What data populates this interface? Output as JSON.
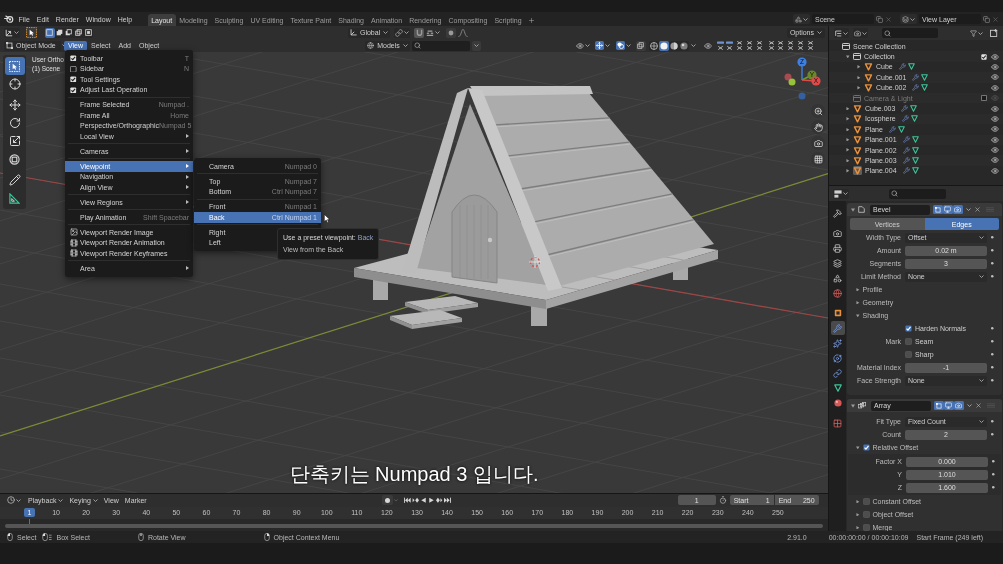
{
  "top_bar": {
    "menus": [
      "File",
      "Edit",
      "Render",
      "Window",
      "Help"
    ],
    "workspaces": [
      {
        "label": "Layout",
        "selected": true
      },
      {
        "label": "Modeling",
        "selected": false
      },
      {
        "label": "Sculpting",
        "selected": false
      },
      {
        "label": "UV Editing",
        "selected": false
      },
      {
        "label": "Texture Paint",
        "selected": false
      },
      {
        "label": "Shading",
        "selected": false
      },
      {
        "label": "Animation",
        "selected": false
      },
      {
        "label": "Rendering",
        "selected": false
      },
      {
        "label": "Compositing",
        "selected": false
      },
      {
        "label": "Scripting",
        "selected": false
      }
    ],
    "scene": "Scene",
    "view_layer": "View Layer"
  },
  "tool_settings": {
    "select_modes": [
      {
        "kind": "set",
        "selected": true
      },
      {
        "kind": "extend",
        "selected": false
      },
      {
        "kind": "subtract",
        "selected": false
      },
      {
        "kind": "difference",
        "selected": false
      },
      {
        "kind": "intersect",
        "selected": false
      }
    ],
    "orientation": "Global",
    "options": "Options"
  },
  "viewport_header": {
    "mode": "Object Mode",
    "menus": [
      {
        "label": "View",
        "selected": true
      },
      {
        "label": "Select",
        "selected": false
      },
      {
        "label": "Add",
        "selected": false
      },
      {
        "label": "Object",
        "selected": false
      }
    ],
    "collection": "Models",
    "gizmos": {
      "on": true
    },
    "overlays": {
      "on": true
    },
    "xray": {
      "on": false
    },
    "shading": [
      {
        "kind": "wireframe",
        "selected": false
      },
      {
        "kind": "solid",
        "selected": true
      },
      {
        "kind": "material",
        "selected": false
      },
      {
        "kind": "rendered",
        "selected": false
      }
    ]
  },
  "toolbar": {
    "groups": [
      {
        "tools": [
          {
            "kind": "select_box",
            "selected": true
          },
          {
            "kind": "cursor",
            "selected": false
          }
        ]
      },
      {
        "tools": [
          {
            "kind": "move",
            "selected": false
          },
          {
            "kind": "rotate",
            "selected": false
          },
          {
            "kind": "scale",
            "selected": false
          },
          {
            "kind": "transform",
            "selected": false
          }
        ]
      },
      {
        "tools": [
          {
            "kind": "annotate",
            "selected": false
          },
          {
            "kind": "measure",
            "selected": false
          }
        ]
      }
    ]
  },
  "viewport": {
    "view_name": "User Ortho",
    "scene_info": "(1) Scene",
    "gizmo_axes": [
      "Z",
      "Y",
      "X"
    ],
    "subtitle": "단축키는 Numpad 3 입니다."
  },
  "view_menu": {
    "sections": [
      {
        "items": [
          {
            "kind": "check",
            "label": "Toolbar",
            "checked": true,
            "shortcut": "T",
            "selected": false
          },
          {
            "kind": "check",
            "label": "Sidebar",
            "checked": false,
            "shortcut": "N",
            "selected": false
          },
          {
            "kind": "check",
            "label": "Tool Settings",
            "checked": true,
            "selected": false
          },
          {
            "kind": "check",
            "label": "Adjust Last Operation",
            "checked": true,
            "selected": false
          }
        ]
      },
      {
        "items": [
          {
            "kind": "action",
            "label": "Frame Selected",
            "shortcut": "Numpad .",
            "selected": false
          },
          {
            "kind": "action",
            "label": "Frame All",
            "shortcut": "Home",
            "selected": false
          },
          {
            "kind": "action",
            "label": "Perspective/Orthographic",
            "shortcut": "Numpad 5",
            "selected": false
          },
          {
            "kind": "submenu",
            "label": "Local View",
            "selected": false
          }
        ]
      },
      {
        "items": [
          {
            "kind": "submenu",
            "label": "Cameras",
            "selected": false
          }
        ]
      },
      {
        "items": [
          {
            "kind": "submenu",
            "label": "Viewpoint",
            "selected": true
          },
          {
            "kind": "submenu",
            "label": "Navigation",
            "selected": false
          },
          {
            "kind": "submenu",
            "label": "Align View",
            "selected": false
          }
        ]
      },
      {
        "items": [
          {
            "kind": "submenu",
            "label": "View Regions",
            "selected": false
          }
        ]
      },
      {
        "items": [
          {
            "kind": "action",
            "label": "Play Animation",
            "shortcut": "Shift Spacebar",
            "selected": false
          }
        ]
      },
      {
        "items": [
          {
            "kind": "render_image",
            "label": "Viewport Render Image",
            "selected": false
          },
          {
            "kind": "render_animation",
            "label": "Viewport Render Animation",
            "selected": false
          },
          {
            "kind": "render_animation",
            "label": "Viewport Render Keyframes",
            "selected": false
          }
        ]
      },
      {
        "items": [
          {
            "kind": "submenu",
            "label": "Area",
            "selected": false
          }
        ]
      }
    ]
  },
  "viewpoint_menu": {
    "sections": [
      {
        "items": [
          {
            "kind": "action",
            "label": "Camera",
            "shortcut": "Numpad 0",
            "selected": false
          }
        ]
      },
      {
        "items": [
          {
            "kind": "action",
            "label": "Top",
            "shortcut": "Numpad 7",
            "selected": false
          },
          {
            "kind": "action",
            "label": "Bottom",
            "shortcut": "Ctrl Numpad 7",
            "selected": false
          }
        ]
      },
      {
        "items": [
          {
            "kind": "action",
            "label": "Front",
            "shortcut": "Numpad 1",
            "selected": false
          },
          {
            "kind": "action",
            "label": "Back",
            "shortcut": "Ctrl Numpad 1",
            "selected": true
          }
        ]
      },
      {
        "items": [
          {
            "kind": "action",
            "label": "Right",
            "selected": false
          },
          {
            "kind": "action",
            "label": "Left",
            "selected": false
          }
        ]
      }
    ]
  },
  "tooltip": {
    "label": "Use a preset viewpoint:",
    "value": "Back",
    "description": "View from the Back"
  },
  "outliner": {
    "tree": [
      {
        "kind": "scene_collection",
        "label": "Scene Collection",
        "children": [
          {
            "kind": "collection",
            "label": "Collection",
            "expanded": true,
            "checked": true,
            "children": [
              {
                "kind": "object",
                "label": "Cube",
                "expanded": false,
                "selected": false
              },
              {
                "kind": "object",
                "label": "Cube.001",
                "expanded": false,
                "selected": false
              },
              {
                "kind": "object",
                "label": "Cube.002",
                "expanded": false,
                "selected": false
              }
            ]
          },
          {
            "kind": "collection",
            "label": "Camera & Light",
            "checked": false
          },
          {
            "kind": "object",
            "label": "Cube.003",
            "expanded": false,
            "selected": false
          },
          {
            "kind": "object",
            "label": "Icosphere",
            "expanded": false,
            "selected": false
          },
          {
            "kind": "object",
            "label": "Plane",
            "expanded": false,
            "selected": false
          },
          {
            "kind": "object",
            "label": "Plane.001",
            "expanded": false,
            "selected": false
          },
          {
            "kind": "object",
            "label": "Plane.002",
            "expanded": false,
            "selected": false
          },
          {
            "kind": "object",
            "label": "Plane.003",
            "expanded": false,
            "selected": false
          },
          {
            "kind": "object",
            "label": "Plane.004",
            "expanded": false,
            "selected": true
          }
        ]
      }
    ]
  },
  "properties": {
    "tab_groups": [
      {
        "tabs": [
          {
            "kind": "tool",
            "selected": false
          }
        ]
      },
      {
        "tabs": [
          {
            "kind": "render",
            "selected": false
          },
          {
            "kind": "output",
            "selected": false
          },
          {
            "kind": "view_layer",
            "selected": false
          },
          {
            "kind": "scene",
            "selected": false
          },
          {
            "kind": "world",
            "selected": false
          }
        ]
      },
      {
        "tabs": [
          {
            "kind": "object",
            "selected": false
          },
          {
            "kind": "modifier",
            "selected": true
          },
          {
            "kind": "particles",
            "selected": false
          },
          {
            "kind": "physics",
            "selected": false
          },
          {
            "kind": "constraints",
            "selected": false
          },
          {
            "kind": "data",
            "selected": false
          },
          {
            "kind": "material",
            "selected": false
          }
        ]
      },
      {
        "tabs": [
          {
            "kind": "texture",
            "selected": false
          }
        ]
      }
    ],
    "modifiers": [
      {
        "kind": "bevel",
        "name": "Bevel",
        "expanded": true,
        "toggles": [
          {
            "kind": "edit_mode",
            "on": true
          },
          {
            "kind": "viewport",
            "on": true
          },
          {
            "kind": "render",
            "on": true
          }
        ],
        "segments": [
          {
            "label": "Vertices",
            "selected": false
          },
          {
            "label": "Edges",
            "selected": true
          }
        ],
        "rows": [
          {
            "kind": "dropdown",
            "label": "Width Type",
            "value": "Offset"
          },
          {
            "kind": "number",
            "label": "Amount",
            "value": "0.02 m"
          },
          {
            "kind": "number",
            "label": "Segments",
            "value": "3"
          },
          {
            "kind": "dropdown",
            "label": "Limit Method",
            "value": "None"
          },
          {
            "kind": "subpanel",
            "label": "Profile",
            "expanded": false
          },
          {
            "kind": "subpanel",
            "label": "Geometry",
            "expanded": false
          },
          {
            "kind": "subpanel",
            "label": "Shading",
            "expanded": true,
            "rows": [
              {
                "kind": "checkbox",
                "label": "Harden Normals",
                "checked": true
              },
              {
                "kind": "checkbox",
                "heading": "Mark",
                "label": "Seam",
                "checked": false
              },
              {
                "kind": "checkbox",
                "label": "Sharp",
                "checked": false
              },
              {
                "kind": "number",
                "label": "Material Index",
                "value": "-1"
              },
              {
                "kind": "dropdown",
                "label": "Face Strength",
                "value": "None"
              }
            ]
          }
        ]
      },
      {
        "kind": "array",
        "name": "Array",
        "expanded": true,
        "toggles": [
          {
            "kind": "edit_mode",
            "on": true
          },
          {
            "kind": "viewport",
            "on": true
          },
          {
            "kind": "render",
            "on": true
          }
        ],
        "rows": [
          {
            "kind": "dropdown",
            "label": "Fit Type",
            "value": "Fixed Count"
          },
          {
            "kind": "number",
            "label": "Count",
            "value": "2"
          },
          {
            "kind": "subpanel_check",
            "label": "Relative Offset",
            "expanded": true,
            "checked": true,
            "rows": [
              {
                "kind": "number",
                "label": "Factor X",
                "value": "0.000"
              },
              {
                "kind": "number",
                "label": "Y",
                "value": "1.010"
              },
              {
                "kind": "number",
                "label": "Z",
                "value": "1.600"
              }
            ]
          },
          {
            "kind": "subpanel_check",
            "label": "Constant Offset",
            "expanded": false,
            "checked": false
          },
          {
            "kind": "subpanel_check",
            "label": "Object Offset",
            "expanded": false,
            "checked": false
          },
          {
            "kind": "subpanel_check",
            "label": "Merge",
            "expanded": false,
            "checked": false
          }
        ]
      }
    ]
  },
  "timeline": {
    "menus": [
      {
        "label": "Playback",
        "kind": "dropdown"
      },
      {
        "label": "Keying",
        "kind": "dropdown"
      },
      {
        "label": "View",
        "kind": "menu"
      },
      {
        "label": "Marker",
        "kind": "menu"
      }
    ],
    "current_frame": "1",
    "start_label": "Start",
    "start": "1",
    "end_label": "End",
    "end": "250",
    "playhead": "1",
    "ticks": [
      "10",
      "20",
      "30",
      "40",
      "50",
      "60",
      "70",
      "80",
      "90",
      "100",
      "110",
      "120",
      "130",
      "140",
      "150",
      "160",
      "170",
      "180",
      "190",
      "200",
      "210",
      "220",
      "230",
      "240",
      "250"
    ]
  },
  "status_bar": {
    "hints": [
      {
        "kind": "left_click",
        "label": "Select"
      },
      {
        "kind": "drag",
        "label": "Box Select"
      },
      {
        "kind": "middle_click",
        "label": "Rotate View"
      },
      {
        "kind": "right_click",
        "label": "Object Context Menu"
      }
    ],
    "version": "2.91.0",
    "time": "00:00:00:00 / 00:00:10:09",
    "frame_info": "Start Frame (249 left)"
  }
}
